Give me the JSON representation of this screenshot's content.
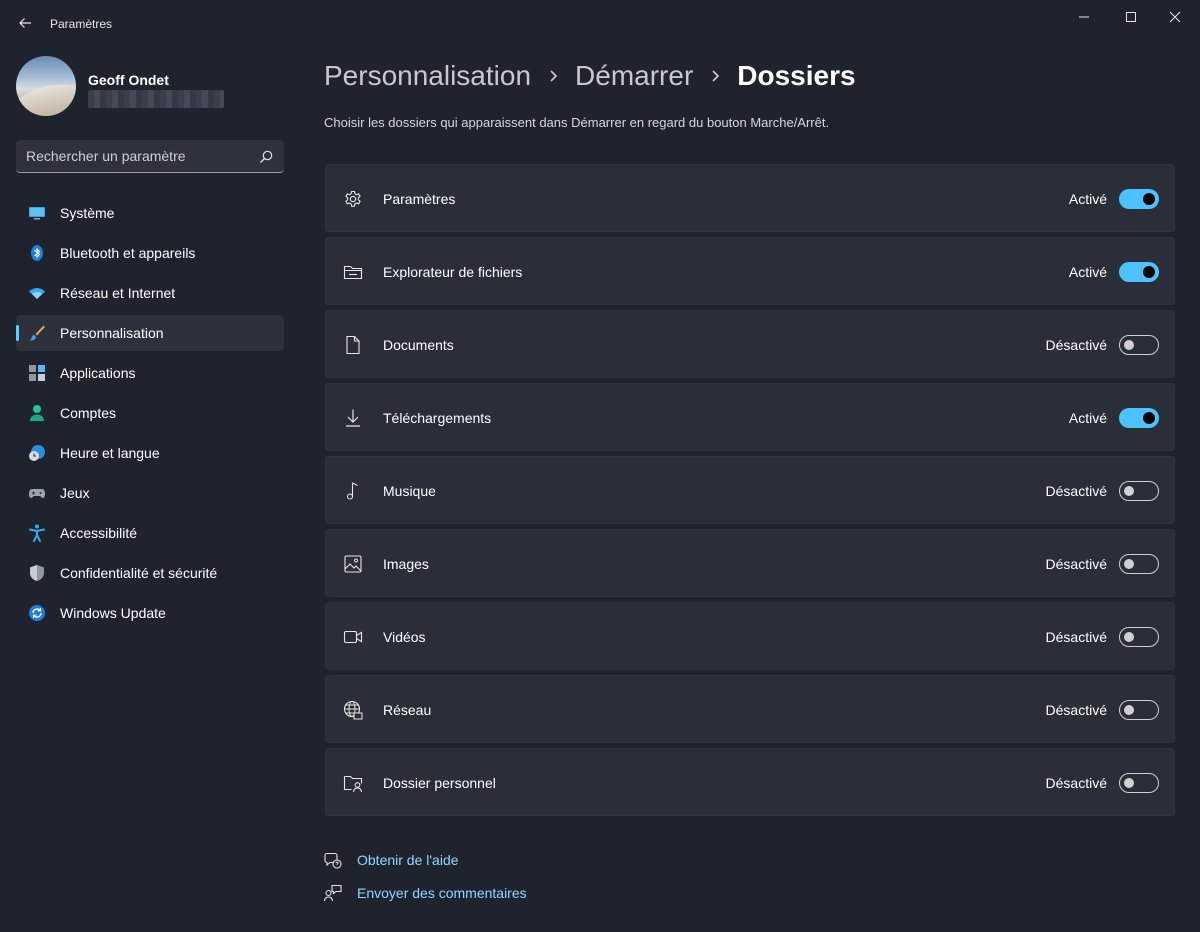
{
  "window": {
    "title": "Paramètres"
  },
  "profile": {
    "name": "Geoff Ondet"
  },
  "search": {
    "placeholder": "Rechercher un paramètre"
  },
  "sidebar": {
    "items": [
      {
        "label": "Système",
        "icon": "monitor-icon"
      },
      {
        "label": "Bluetooth et appareils",
        "icon": "bluetooth-icon"
      },
      {
        "label": "Réseau et Internet",
        "icon": "wifi-icon"
      },
      {
        "label": "Personnalisation",
        "icon": "paintbrush-icon",
        "active": true
      },
      {
        "label": "Applications",
        "icon": "apps-icon"
      },
      {
        "label": "Comptes",
        "icon": "account-icon"
      },
      {
        "label": "Heure et langue",
        "icon": "clock-globe-icon"
      },
      {
        "label": "Jeux",
        "icon": "gamepad-icon"
      },
      {
        "label": "Accessibilité",
        "icon": "accessibility-icon"
      },
      {
        "label": "Confidentialité et sécurité",
        "icon": "shield-icon"
      },
      {
        "label": "Windows Update",
        "icon": "update-icon"
      }
    ]
  },
  "breadcrumb": {
    "level1": "Personnalisation",
    "level2": "Démarrer",
    "current": "Dossiers"
  },
  "subtitle": "Choisir les dossiers qui apparaissent dans Démarrer en regard du bouton Marche/Arrêt.",
  "folders": [
    {
      "label": "Paramètres",
      "state": "Activé",
      "on": true,
      "icon": "gear-icon"
    },
    {
      "label": "Explorateur de fichiers",
      "state": "Activé",
      "on": true,
      "icon": "file-explorer-icon"
    },
    {
      "label": "Documents",
      "state": "Désactivé",
      "on": false,
      "icon": "document-icon"
    },
    {
      "label": "Téléchargements",
      "state": "Activé",
      "on": true,
      "icon": "download-icon"
    },
    {
      "label": "Musique",
      "state": "Désactivé",
      "on": false,
      "icon": "music-note-icon"
    },
    {
      "label": "Images",
      "state": "Désactivé",
      "on": false,
      "icon": "image-icon"
    },
    {
      "label": "Vidéos",
      "state": "Désactivé",
      "on": false,
      "icon": "video-icon"
    },
    {
      "label": "Réseau",
      "state": "Désactivé",
      "on": false,
      "icon": "network-globe-icon"
    },
    {
      "label": "Dossier personnel",
      "state": "Désactivé",
      "on": false,
      "icon": "personal-folder-icon"
    }
  ],
  "links": {
    "help": "Obtenir de l'aide",
    "feedback": "Envoyer des commentaires"
  },
  "colors": {
    "accent": "#4cc2ff",
    "background": "#1f232e",
    "card": "#2a2e39",
    "link": "#8fd8ff"
  }
}
